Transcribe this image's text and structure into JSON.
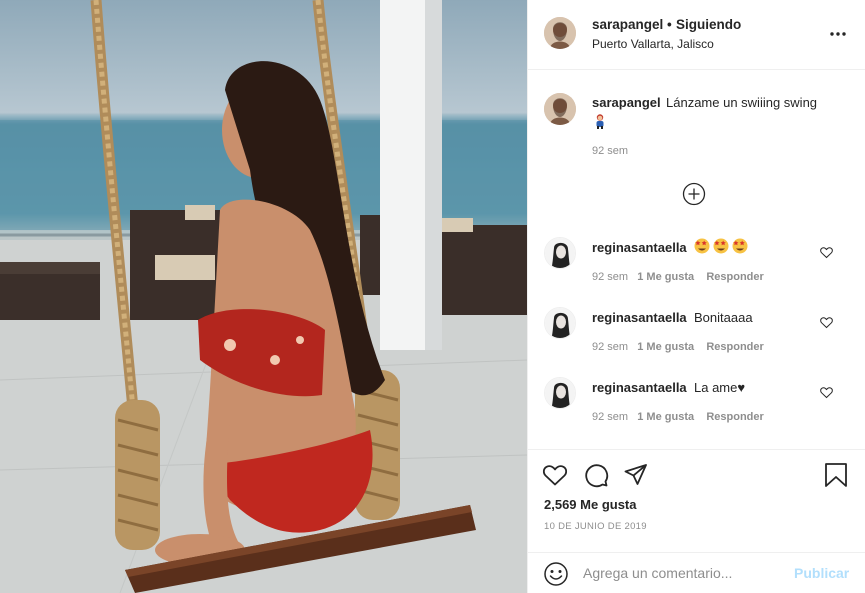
{
  "post_image": {
    "alt": "photo"
  },
  "header": {
    "username": "sarapangel",
    "separator": "•",
    "follow_status": "Siguiendo",
    "location": "Puerto Vallarta, Jalisco",
    "more_icon": "ellipsis-icon"
  },
  "caption": {
    "username": "sarapangel",
    "text": "Lánzame un swiiing swing",
    "time": "92 sem"
  },
  "load_more_icon": "plus-circle-icon",
  "comments": [
    {
      "username": "reginasantaella",
      "text": "",
      "time": "92 sem",
      "likes": "1 Me gusta",
      "reply": "Responder"
    },
    {
      "username": "reginasantaella",
      "text": "Bonitaaaa",
      "time": "92 sem",
      "likes": "1 Me gusta",
      "reply": "Responder"
    },
    {
      "username": "reginasantaella",
      "text": "La ame♥",
      "time": "92 sem",
      "likes": "1 Me gusta",
      "reply": "Responder"
    }
  ],
  "actions": {
    "like_icon": "heart-icon",
    "comment_icon": "comment-icon",
    "share_icon": "send-icon",
    "save_icon": "bookmark-icon",
    "likes_count": "2,569 Me gusta",
    "date": "10 DE JUNIO DE 2019"
  },
  "add_comment": {
    "placeholder": "Agrega un comentario...",
    "post_label": "Publicar"
  },
  "colors": {
    "link_disabled": "#b2dffc",
    "muted": "#8e8e8e",
    "text": "#262626",
    "border": "#efefef"
  }
}
